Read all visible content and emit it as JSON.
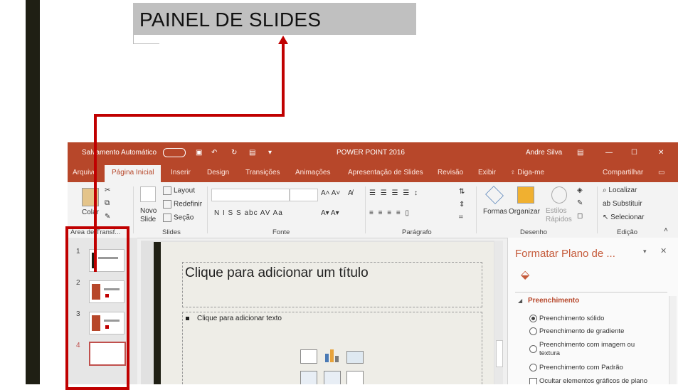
{
  "caption": {
    "text": "PAINEL DE SLIDES"
  },
  "titlebar": {
    "autosave": "Salvamento Automático",
    "doc_title": "POWER POINT 2016",
    "user": "Andre Silva",
    "minimize": "—",
    "maximize": "☐",
    "close": "✕"
  },
  "tabs": [
    "Arquivo",
    "Página Inicial",
    "Inserir",
    "Design",
    "Transições",
    "Animações",
    "Apresentação de Slides",
    "Revisão",
    "Exibir",
    "♀ Diga-me",
    "Compartilhar"
  ],
  "ribbon": {
    "paste": "Colar",
    "new_slide": "Novo Slide",
    "layout": "Layout",
    "reset": "Redefinir",
    "section": "Seção",
    "font_buttons": "N  I  S  S  abc  AV  Aa",
    "formas": "Formas",
    "organizar": "Organizar",
    "estilos": "Estilos Rápidos",
    "localizar": "Localizar",
    "substituir": "Substituir",
    "selecionar": "Selecionar",
    "groups": {
      "area": "Área de Transf...",
      "slides": "Slides",
      "fonte": "Fonte",
      "paragrafo": "Parágrafo",
      "desenho": "Desenho",
      "edicao": "Edição"
    }
  },
  "slides_panel": {
    "numbers": [
      "1",
      "2",
      "3",
      "4"
    ]
  },
  "slide": {
    "title_placeholder": "Clique para adicionar um título",
    "body_placeholder": "Clique para adicionar texto"
  },
  "format_pane": {
    "title": "Formatar Plano de ...",
    "section": "Preenchimento",
    "options": [
      "Preenchimento sólido",
      "Preenchimento de gradiente",
      "Preenchimento com imagem ou textura",
      "Preenchimento com Padrão",
      "Ocultar elementos gráficos de plano"
    ]
  },
  "colors": {
    "brand": "#b7472a",
    "highlight": "#c00000"
  }
}
